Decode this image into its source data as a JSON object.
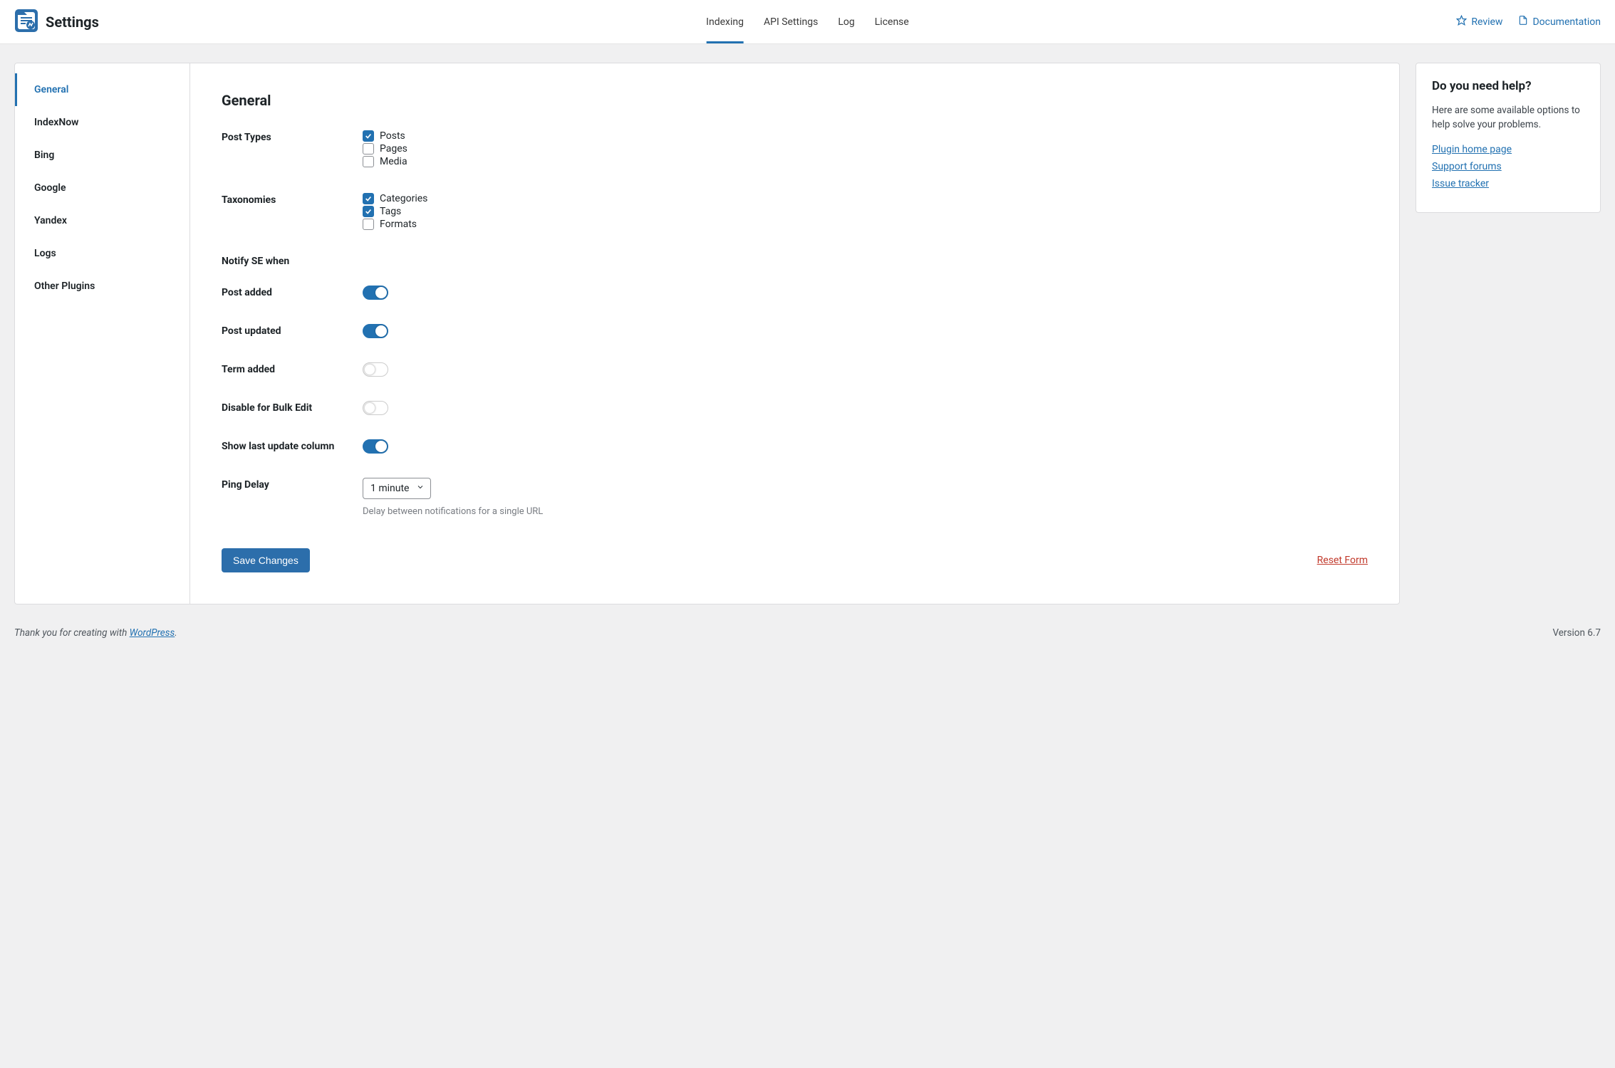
{
  "header": {
    "title": "Settings",
    "tabs": [
      {
        "label": "Indexing",
        "active": true
      },
      {
        "label": "API Settings",
        "active": false
      },
      {
        "label": "Log",
        "active": false
      },
      {
        "label": "License",
        "active": false
      }
    ],
    "review": "Review",
    "documentation": "Documentation"
  },
  "sidebar": {
    "items": [
      {
        "label": "General",
        "active": true
      },
      {
        "label": "IndexNow"
      },
      {
        "label": "Bing"
      },
      {
        "label": "Google"
      },
      {
        "label": "Yandex"
      },
      {
        "label": "Logs"
      },
      {
        "label": "Other Plugins"
      }
    ]
  },
  "main": {
    "heading": "General",
    "post_types": {
      "label": "Post Types",
      "options": [
        {
          "label": "Posts",
          "checked": true
        },
        {
          "label": "Pages",
          "checked": false
        },
        {
          "label": "Media",
          "checked": false
        }
      ]
    },
    "taxonomies": {
      "label": "Taxonomies",
      "options": [
        {
          "label": "Categories",
          "checked": true
        },
        {
          "label": "Tags",
          "checked": true
        },
        {
          "label": "Formats",
          "checked": false
        }
      ]
    },
    "notify_heading": "Notify SE when",
    "toggles": {
      "post_added": {
        "label": "Post added",
        "on": true
      },
      "post_updated": {
        "label": "Post updated",
        "on": true
      },
      "term_added": {
        "label": "Term added",
        "on": false
      },
      "bulk_edit": {
        "label": "Disable for Bulk Edit",
        "on": false
      },
      "last_update": {
        "label": "Show last update column",
        "on": true
      }
    },
    "ping_delay": {
      "label": "Ping Delay",
      "value": "1 minute",
      "hint": "Delay between notifications for a single URL"
    },
    "save": "Save Changes",
    "reset": "Reset Form"
  },
  "help": {
    "title": "Do you need help?",
    "intro": "Here are some available options to help solve your problems.",
    "links": [
      "Plugin home page",
      "Support forums",
      "Issue tracker"
    ]
  },
  "footer": {
    "thanks_prefix": "Thank you for creating with ",
    "thanks_link": "WordPress",
    "thanks_suffix": ".",
    "version": "Version 6.7"
  }
}
